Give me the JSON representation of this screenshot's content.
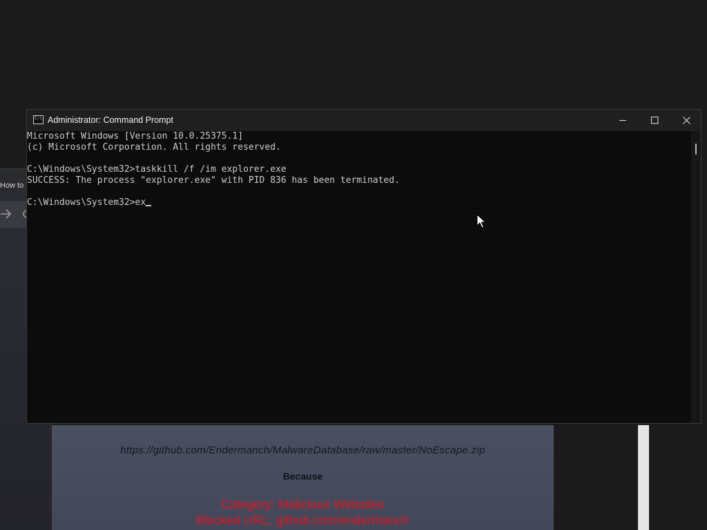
{
  "background_browser": {
    "tab_label": "How to"
  },
  "background_page": {
    "url": "https://github.com/Endermanch/MalwareDatabase/raw/master/NoEscape.zip",
    "because": "Because",
    "category": "Category: Malicious Websites",
    "blocked_url": "Blocked URL: github.com/endermanch"
  },
  "cmd_window": {
    "icon_text": "C:\\",
    "title": "Administrator: Command Prompt",
    "lines": [
      "Microsoft Windows [Version 10.0.25375.1]",
      "(c) Microsoft Corporation. All rights reserved.",
      "",
      "C:\\Windows\\System32>taskkill /f /im explorer.exe",
      "SUCCESS: The process \"explorer.exe\" with PID 836 has been terminated.",
      "",
      "C:\\Windows\\System32>ex"
    ]
  },
  "colors": {
    "console_background": "#0c0c0c",
    "console_text": "#cccccc",
    "titlebar": "#1f1f1f",
    "blocked_text": "#e0141e"
  },
  "icons": {
    "app": "cmd-icon",
    "minimize": "minimize-icon",
    "maximize": "maximize-icon",
    "close": "close-icon",
    "pointer": "mouse-pointer-icon"
  }
}
